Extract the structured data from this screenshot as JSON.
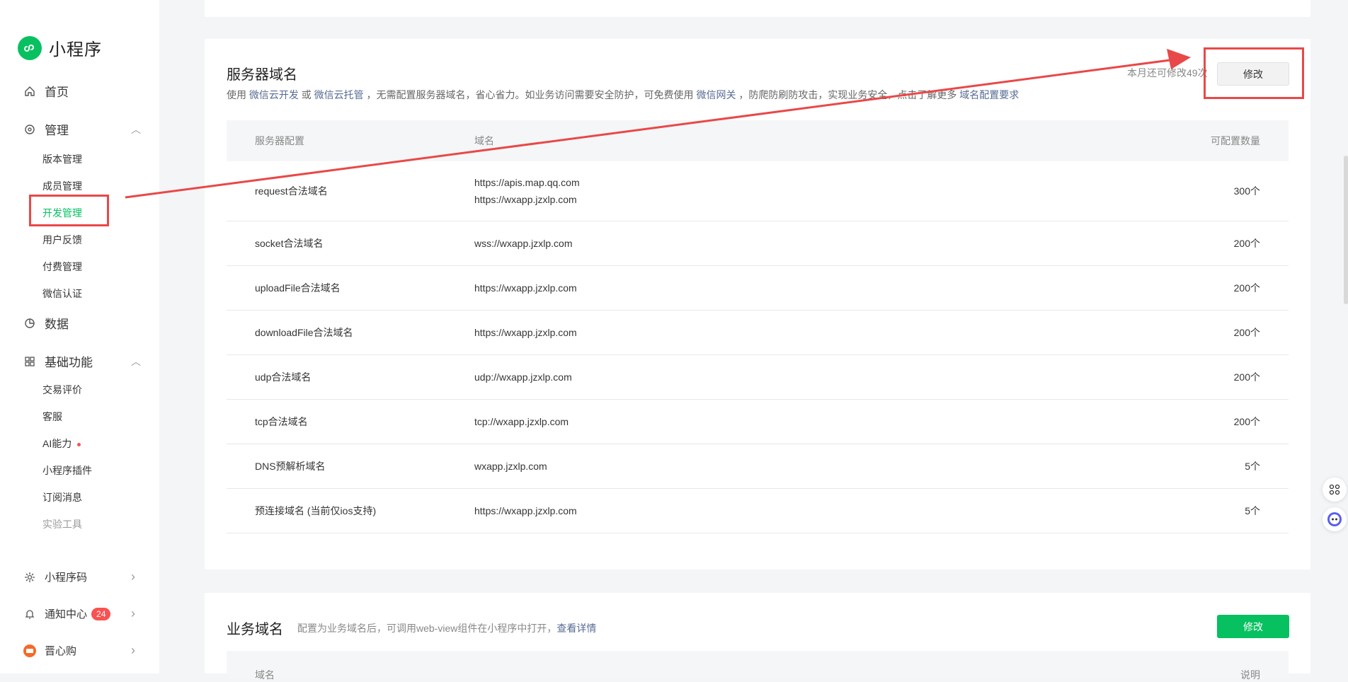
{
  "brand": {
    "name": "小程序"
  },
  "nav": {
    "home": "首页",
    "manage": "管理",
    "manage_items": [
      "版本管理",
      "成员管理",
      "开发管理",
      "用户反馈",
      "付费管理",
      "微信认证"
    ],
    "data": "数据",
    "basic": "基础功能",
    "basic_items": [
      "交易评价",
      "客服",
      "AI能力",
      "小程序插件",
      "订阅消息",
      "实验工具"
    ],
    "qrcode": "小程序码",
    "notify": "通知中心",
    "notify_badge": "24",
    "shop": "晋心购"
  },
  "server_domain": {
    "title": "服务器域名",
    "desc_parts": {
      "p1": "使用 ",
      "l1": "微信云开发",
      "p2": " 或 ",
      "l2": "微信云托管",
      "p3": " ，无需配置服务器域名，省心省力。如业务访问需要安全防护，可免费使用 ",
      "l3": "微信网关",
      "p4": " ，防爬防刷防攻击，实现业务安全，点击了解更多 ",
      "l4": "域名配置要求"
    },
    "quota_text": "本月还可修改49次",
    "modify_label": "修改",
    "headers": [
      "服务器配置",
      "域名",
      "可配置数量"
    ],
    "rows": [
      {
        "name": "request合法域名",
        "domains": [
          "https://apis.map.qq.com",
          "https://wxapp.jzxlp.com"
        ],
        "count": "300个"
      },
      {
        "name": "socket合法域名",
        "domains": [
          "wss://wxapp.jzxlp.com"
        ],
        "count": "200个"
      },
      {
        "name": "uploadFile合法域名",
        "domains": [
          "https://wxapp.jzxlp.com"
        ],
        "count": "200个"
      },
      {
        "name": "downloadFile合法域名",
        "domains": [
          "https://wxapp.jzxlp.com"
        ],
        "count": "200个"
      },
      {
        "name": "udp合法域名",
        "domains": [
          "udp://wxapp.jzxlp.com"
        ],
        "count": "200个"
      },
      {
        "name": "tcp合法域名",
        "domains": [
          "tcp://wxapp.jzxlp.com"
        ],
        "count": "200个"
      },
      {
        "name": "DNS预解析域名",
        "domains": [
          "wxapp.jzxlp.com"
        ],
        "count": "5个"
      },
      {
        "name": "预连接域名 (当前仅ios支持)",
        "domains": [
          "https://wxapp.jzxlp.com"
        ],
        "count": "5个"
      }
    ]
  },
  "biz_domain": {
    "title": "业务域名",
    "desc": "配置为业务域名后，可调用web-view组件在小程序中打开，",
    "link": "查看详情",
    "modify_label": "修改",
    "headers": [
      "域名",
      "说明"
    ]
  },
  "colors": {
    "accent": "#07c160",
    "highlight": "#e94848",
    "link": "#576b95"
  }
}
